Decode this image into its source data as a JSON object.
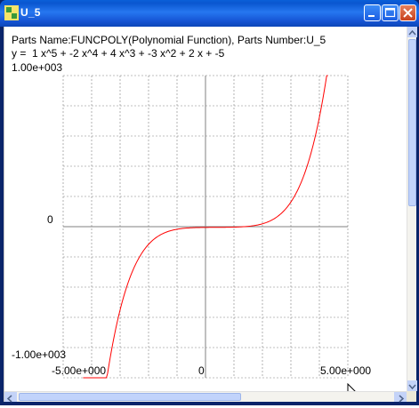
{
  "window": {
    "title": "U_5",
    "icon": "app-icon"
  },
  "header": {
    "parts_line": "Parts Name:FUNCPOLY(Polynomial Function), Parts Number:U_5",
    "equation": "y =  1 x^5 + -2 x^4 + 4 x^3 + -3 x^2 + 2 x + -5"
  },
  "chart_data": {
    "type": "line",
    "xlabel": "",
    "ylabel": "",
    "xlim": [
      -5,
      5
    ],
    "ylim": [
      -1000,
      1000
    ],
    "grid": true,
    "x_tick_labels": {
      "left": "-5.00e+000",
      "center": "0",
      "right": "5.00e+000"
    },
    "y_tick_labels": {
      "top": "1.00e+003",
      "center": "0",
      "bottom": "-1.00e+003"
    },
    "coefficients": [
      1,
      -2,
      4,
      -3,
      2,
      -5
    ],
    "series_color": "#ff0000",
    "x": [
      -4.3,
      -4.0,
      -3.5,
      -3.0,
      -2.5,
      -2.0,
      -1.5,
      -1.0,
      -0.5,
      0,
      0.5,
      1.0,
      1.5,
      2.0,
      2.5,
      3.0,
      3.5,
      4.0,
      4.3
    ],
    "values": [
      -1000,
      -769,
      -426,
      -212,
      -94,
      -37,
      -15,
      -7,
      -6,
      -5,
      -4.6,
      -3,
      1,
      29,
      31,
      103,
      311,
      775,
      1000
    ]
  },
  "colors": {
    "titlebar": "#0a56d0",
    "curve": "#ff0000",
    "grid": "#808080"
  }
}
